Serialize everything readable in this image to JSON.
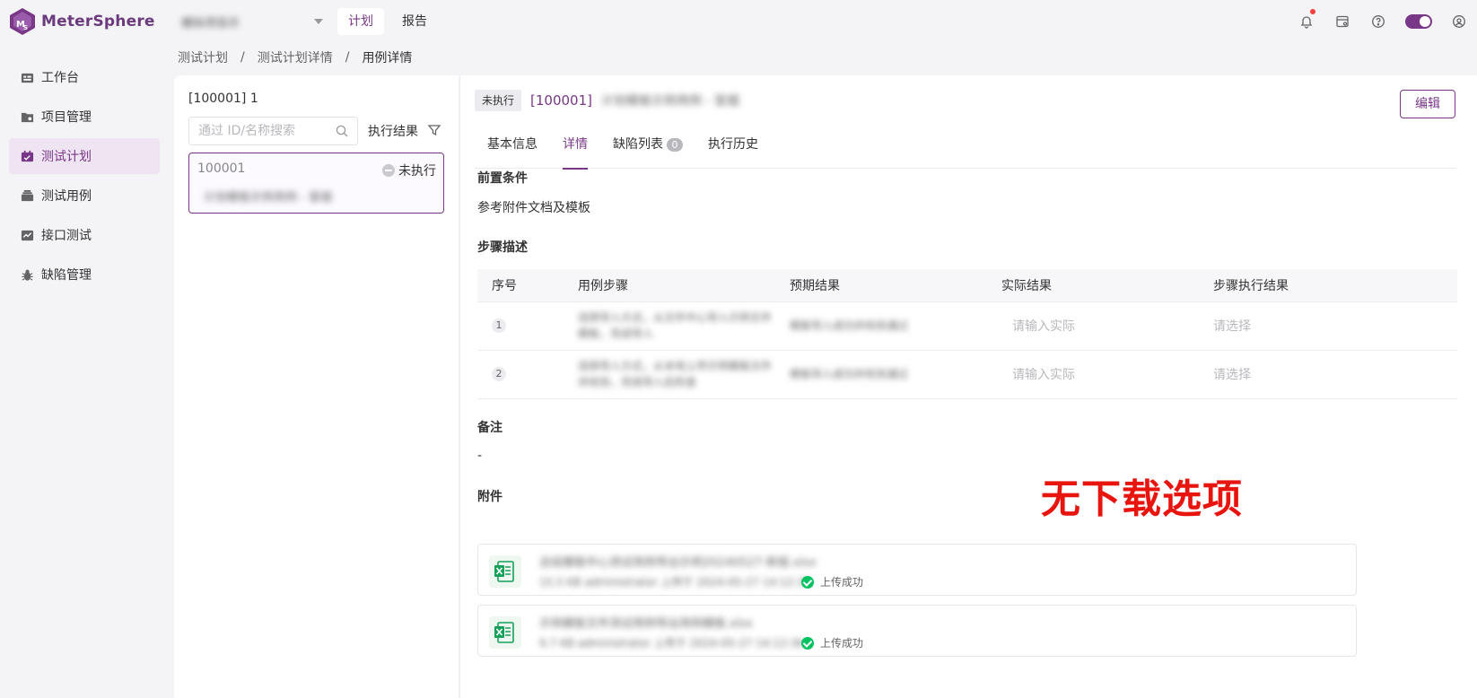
{
  "app": {
    "name": "MeterSphere"
  },
  "header": {
    "project_name": "模拟项目示",
    "nav": [
      {
        "label": "计划",
        "active": true
      },
      {
        "label": "报告",
        "active": false
      }
    ],
    "icons": [
      "bell-icon",
      "task-center-icon",
      "help-icon",
      "theme-toggle",
      "user-settings-icon"
    ]
  },
  "sidebar": {
    "items": [
      {
        "label": "工作台",
        "icon": "workbench-icon",
        "active": false
      },
      {
        "label": "项目管理",
        "icon": "project-icon",
        "active": false
      },
      {
        "label": "测试计划",
        "icon": "test-plan-icon",
        "active": true
      },
      {
        "label": "测试用例",
        "icon": "test-case-icon",
        "active": false
      },
      {
        "label": "接口测试",
        "icon": "api-test-icon",
        "active": false
      },
      {
        "label": "缺陷管理",
        "icon": "bug-icon",
        "active": false
      }
    ]
  },
  "breadcrumb": {
    "items": [
      "测试计划",
      "测试计划详情",
      "用例详情"
    ],
    "separator": "/"
  },
  "case_list": {
    "title": "[100001] 1",
    "search_placeholder": "通过 ID/名称搜索",
    "filter_label": "执行结果",
    "cards": [
      {
        "id": "100001",
        "status": "未执行",
        "name": "计划模板示例用例 - 冒烟"
      }
    ]
  },
  "detail": {
    "status_tag": "未执行",
    "id": "[100001]",
    "name": "计划模板示例用例 - 冒烟",
    "edit_label": "编辑",
    "tabs": [
      {
        "label": "基本信息",
        "active": false
      },
      {
        "label": "详情",
        "active": true
      },
      {
        "label": "缺陷列表",
        "active": false,
        "badge": "0"
      },
      {
        "label": "执行历史",
        "active": false
      }
    ],
    "precondition": {
      "title": "前置条件",
      "text": "参考附件文档及模板"
    },
    "steps": {
      "title": "步骤描述",
      "columns": [
        "序号",
        "用例步骤",
        "预期结果",
        "实际结果",
        "步骤执行结果"
      ],
      "rows": [
        {
          "index": "1",
          "step": "选择导入方式，从文件中心导入示例文件模板，完成导入",
          "expected": "模板导入成功并校验通过",
          "actual_placeholder": "请输入实际",
          "result_placeholder": "请选择"
        },
        {
          "index": "2",
          "step": "选择导入方式，从本地上传示例模板文件并校验，完成导入后检查",
          "expected": "模板导入成功并校验通过",
          "actual_placeholder": "请输入实际",
          "result_placeholder": "请选择"
        }
      ]
    },
    "remark": {
      "title": "备注",
      "text": "-"
    },
    "attachments": {
      "title": "附件",
      "files": [
        {
          "name": "总结模板中心测试用例导出示例20240527-新版.xlsx",
          "meta": "15.5 KB  administrator  上传于 2024-05-27 14:12:36",
          "status": "上传成功"
        },
        {
          "name": "示例模板文件测试用例导出用例模板.xlsx",
          "meta": "9.7 KB  administrator  上传于 2024-05-27 14:12:36",
          "status": "上传成功"
        }
      ]
    }
  },
  "annotation": {
    "text": "无下载选项",
    "color": "#e8140e"
  },
  "colors": {
    "primary": "#783887",
    "success": "#00c261",
    "text": "#323233"
  }
}
